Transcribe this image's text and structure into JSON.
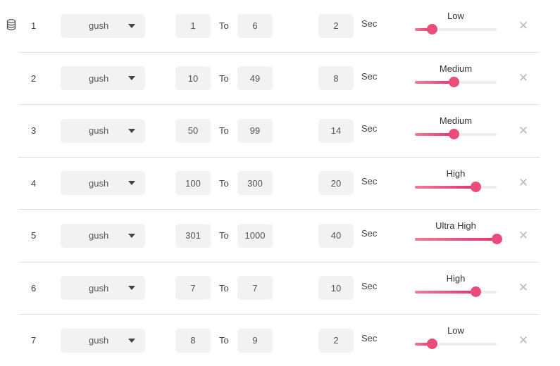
{
  "header": {
    "icon": "database-icon"
  },
  "labels": {
    "to": "To",
    "sec": "Sec"
  },
  "rows": [
    {
      "index": "1",
      "type": "gush",
      "from": "1",
      "to": "6",
      "duration": "2",
      "level": "Low",
      "level_value": 0.21
    },
    {
      "index": "2",
      "type": "gush",
      "from": "10",
      "to": "49",
      "duration": "8",
      "level": "Medium",
      "level_value": 0.47
    },
    {
      "index": "3",
      "type": "gush",
      "from": "50",
      "to": "99",
      "duration": "14",
      "level": "Medium",
      "level_value": 0.47
    },
    {
      "index": "4",
      "type": "gush",
      "from": "100",
      "to": "300",
      "duration": "20",
      "level": "High",
      "level_value": 0.74
    },
    {
      "index": "5",
      "type": "gush",
      "from": "301",
      "to": "1000",
      "duration": "40",
      "level": "Ultra High",
      "level_value": 1.0
    },
    {
      "index": "6",
      "type": "gush",
      "from": "7",
      "to": "7",
      "duration": "10",
      "level": "High",
      "level_value": 0.74
    },
    {
      "index": "7",
      "type": "gush",
      "from": "8",
      "to": "9",
      "duration": "2",
      "level": "Low",
      "level_value": 0.21
    }
  ],
  "colors": {
    "slider_fill_start": "#f47a96",
    "slider_fill_end": "#e2356a",
    "slider_thumb": "#ea4d7a",
    "slider_track": "#eeeeee",
    "field_bg": "#f2f2f2"
  }
}
